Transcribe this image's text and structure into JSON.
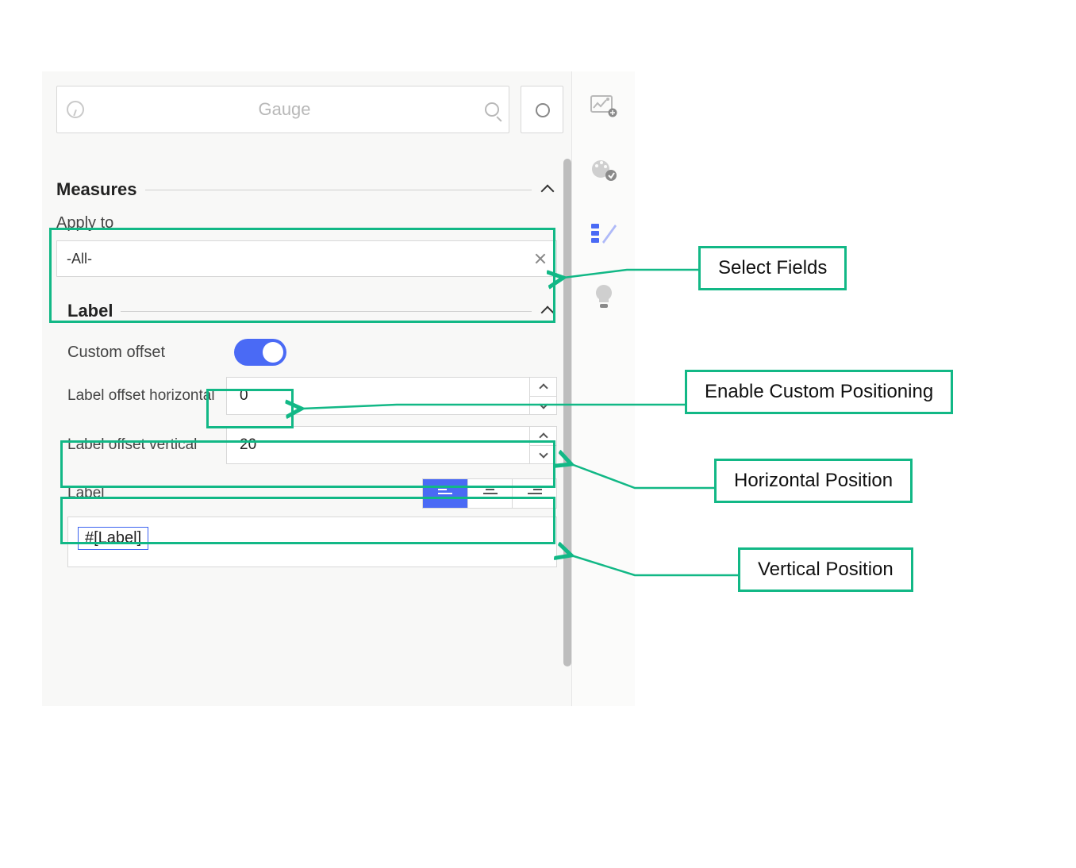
{
  "search": {
    "placeholder": "Gauge"
  },
  "sections": {
    "measures": {
      "title": "Measures"
    },
    "label": {
      "title": "Label"
    }
  },
  "apply_to": {
    "label": "Apply to",
    "value": "-All-"
  },
  "custom_offset": {
    "label": "Custom offset",
    "enabled": true
  },
  "offset_h": {
    "label": "Label offset horizontal",
    "value": "0"
  },
  "offset_v": {
    "label": "Label offset vertical",
    "value": "20"
  },
  "label_field": {
    "label": "Label",
    "token": "#[Label]",
    "align": "left"
  },
  "annotations": {
    "select_fields": "Select Fields",
    "enable_custom": "Enable Custom Positioning",
    "horizontal": "Horizontal Position",
    "vertical": "Vertical Position"
  }
}
